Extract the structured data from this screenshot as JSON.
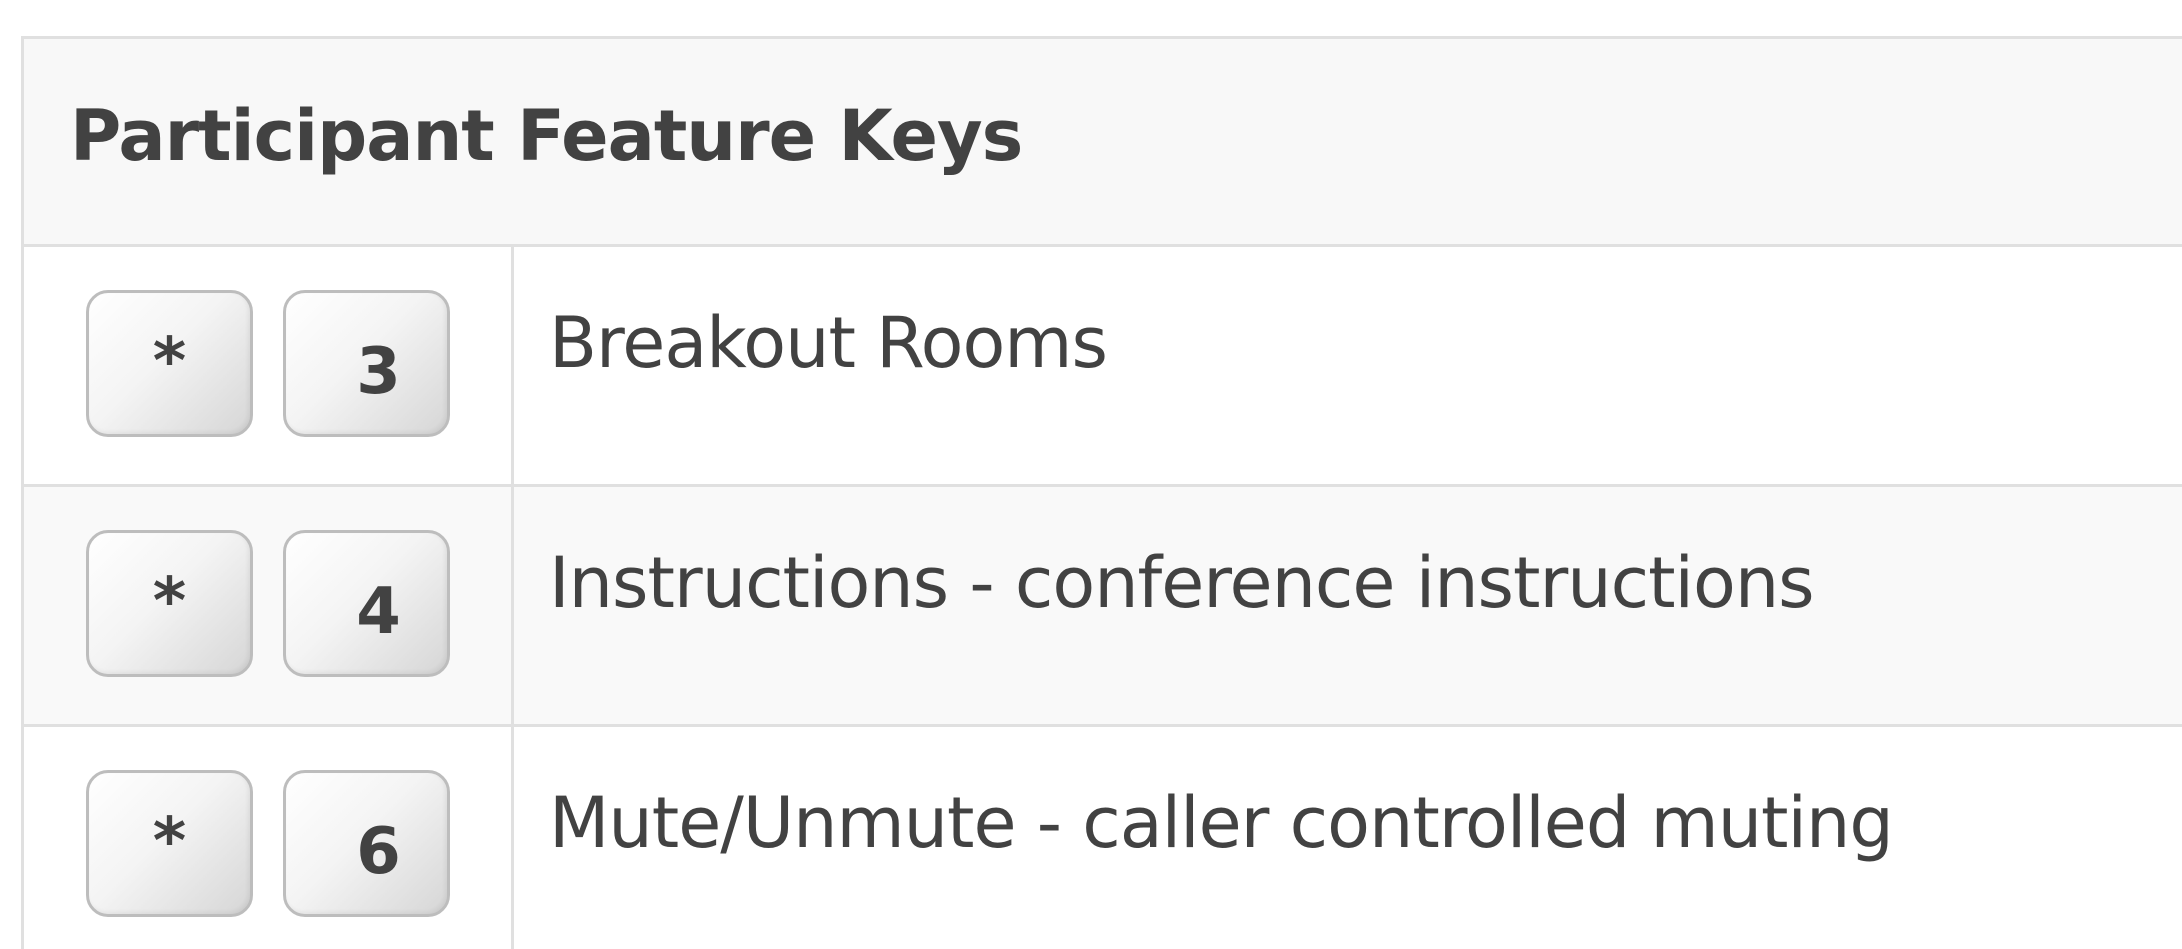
{
  "panel": {
    "title": "Participant Feature Keys"
  },
  "rows": [
    {
      "keys": [
        "*",
        "3"
      ],
      "description": "Breakout Rooms"
    },
    {
      "keys": [
        "*",
        "4"
      ],
      "description": "Instructions - conference instructions"
    },
    {
      "keys": [
        "*",
        "6"
      ],
      "description": "Mute/Unmute - caller controlled muting"
    }
  ]
}
